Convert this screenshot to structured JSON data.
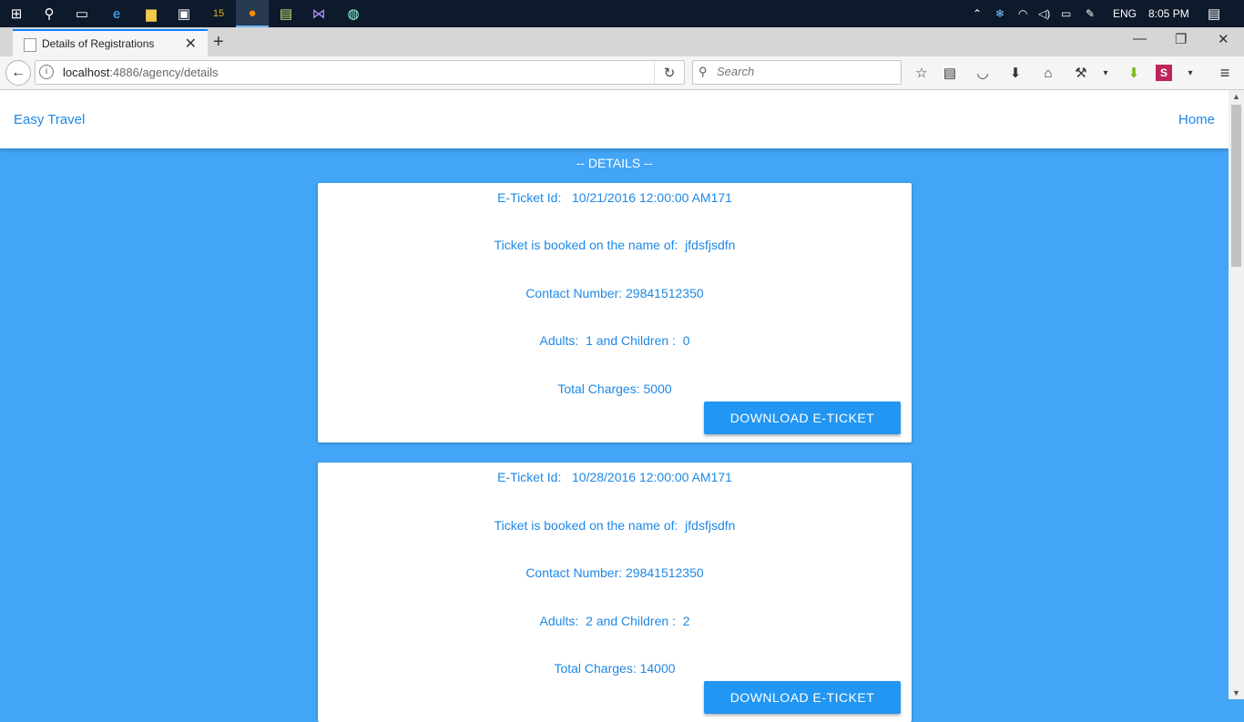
{
  "taskbar": {
    "language": "ENG",
    "clock": "8:05 PM"
  },
  "browser": {
    "tab_title": "Details of Registrations",
    "url_host": "localhost",
    "url_rest": ":4886/agency/details",
    "search_placeholder": "Search"
  },
  "page": {
    "brand": "Easy Travel",
    "home": "Home",
    "heading": "-- DETAILS --",
    "tickets": [
      {
        "eticket_line": "E-Ticket Id:   10/21/2016 12:00:00 AM171",
        "name_line": "Ticket is booked on the name of:  jfdsfjsdfn",
        "contact_line": "Contact Number: 29841512350",
        "pax_line": "Adults:  1 and Children :  0",
        "charges_line": "Total Charges: 5000",
        "download_label": "DOWNLOAD E-TICKET"
      },
      {
        "eticket_line": "E-Ticket Id:   10/28/2016 12:00:00 AM171",
        "name_line": "Ticket is booked on the name of:  jfdsfjsdfn",
        "contact_line": "Contact Number: 29841512350",
        "pax_line": "Adults:  2 and Children :  2",
        "charges_line": "Total Charges: 14000",
        "download_label": "DOWNLOAD E-TICKET"
      }
    ]
  }
}
